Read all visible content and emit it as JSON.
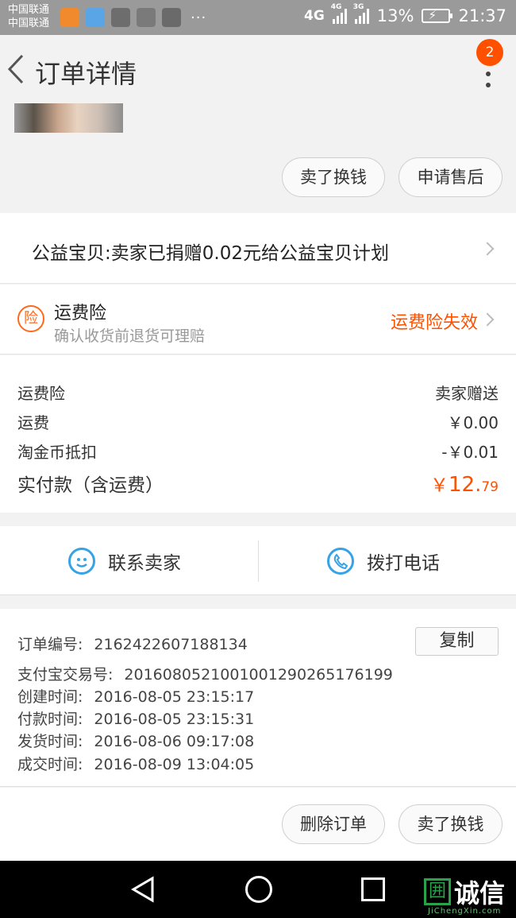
{
  "status_bar": {
    "carrier_1": "中国联通",
    "carrier_2": "中国联通",
    "dots": "···",
    "net_1": "4G",
    "net_2": "4G",
    "net_3": "3G",
    "battery": "13%",
    "time": "21:37"
  },
  "header": {
    "title": "订单详情",
    "badge": "2"
  },
  "top_actions": {
    "sell_label": "卖了换钱",
    "after_sale_label": "申请售后"
  },
  "charity": {
    "text": "公益宝贝:卖家已捐赠0.02元给公益宝贝计划"
  },
  "insurance": {
    "icon_char": "险",
    "title": "运费险",
    "subtitle": "确认收货前退货可理赔",
    "status": "运费险失效"
  },
  "fees": [
    {
      "label": "运费险",
      "value": "卖家赠送"
    },
    {
      "label": "运费",
      "value": "￥0.00"
    },
    {
      "label": "淘金币抵扣",
      "value": "-￥0.01"
    }
  ],
  "total": {
    "label": "实付款（含运费）",
    "currency": "￥",
    "integer": "12.",
    "decimal": "79"
  },
  "contact": {
    "seller_label": "联系卖家",
    "phone_label": "拨打电话"
  },
  "order_info": {
    "copy_label": "复制",
    "rows": [
      {
        "label": "订单编号:",
        "value": "2162422607188134"
      },
      {
        "label": "支付宝交易号:",
        "value": "2016080521001001290265176199"
      },
      {
        "label": "创建时间:",
        "value": "2016-08-05 23:15:17"
      },
      {
        "label": "付款时间:",
        "value": "2016-08-05 23:15:31"
      },
      {
        "label": "发货时间:",
        "value": "2016-08-06 09:17:08"
      },
      {
        "label": "成交时间:",
        "value": "2016-08-09 13:04:05"
      }
    ]
  },
  "bottom_actions": {
    "delete_label": "删除订单",
    "sell_label": "卖了换钱"
  },
  "watermark": {
    "box_char": "囲",
    "text": "诚信",
    "sub": "JiChengXin.com"
  },
  "colors": {
    "accent": "#ff5000",
    "contact_icon": "#36a3e6",
    "status_bar": "#9a9a9a"
  }
}
